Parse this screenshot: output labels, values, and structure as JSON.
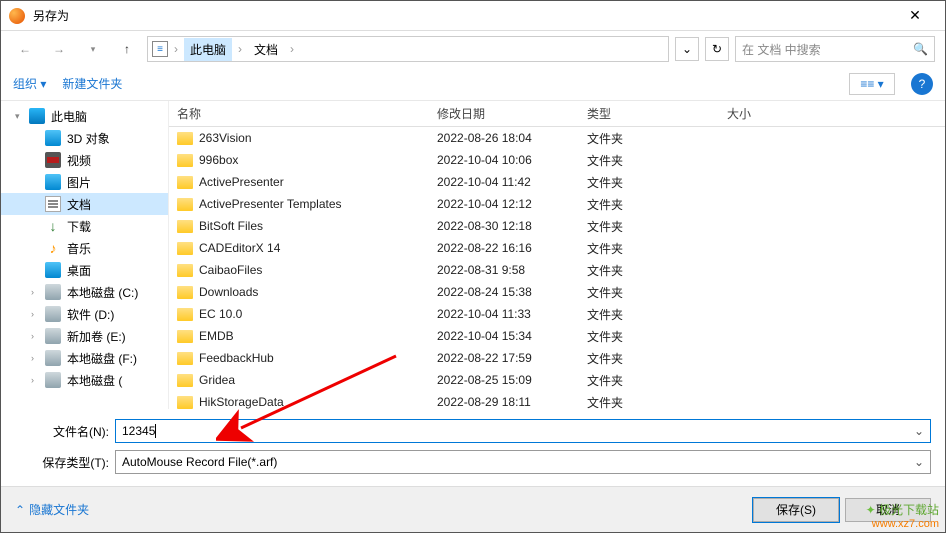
{
  "window": {
    "title": "另存为"
  },
  "breadcrumb": {
    "loc1": "此电脑",
    "loc2": "文档"
  },
  "search": {
    "placeholder": "在 文档 中搜索"
  },
  "toolbar": {
    "organize": "组织",
    "newfolder": "新建文件夹"
  },
  "sidebar": [
    {
      "label": "此电脑",
      "icon": "ico-pc",
      "indent": false,
      "exp": "▾"
    },
    {
      "label": "3D 对象",
      "icon": "ico-3d",
      "indent": true
    },
    {
      "label": "视频",
      "icon": "ico-video",
      "indent": true
    },
    {
      "label": "图片",
      "icon": "ico-pic",
      "indent": true
    },
    {
      "label": "文档",
      "icon": "ico-doc",
      "indent": true,
      "selected": true
    },
    {
      "label": "下载",
      "icon": "ico-dl",
      "indent": true,
      "glyph": "↓"
    },
    {
      "label": "音乐",
      "icon": "ico-music",
      "indent": true,
      "glyph": "♪"
    },
    {
      "label": "桌面",
      "icon": "ico-desk",
      "indent": true
    },
    {
      "label": "本地磁盘 (C:)",
      "icon": "ico-disk",
      "indent": true,
      "exp2": "›"
    },
    {
      "label": "软件 (D:)",
      "icon": "ico-disk",
      "indent": true,
      "exp2": "›"
    },
    {
      "label": "新加卷 (E:)",
      "icon": "ico-disk",
      "indent": true,
      "exp2": "›"
    },
    {
      "label": "本地磁盘 (F:)",
      "icon": "ico-disk",
      "indent": true,
      "exp2": "›"
    },
    {
      "label": "本地磁盘 (",
      "icon": "ico-disk",
      "indent": true,
      "exp2": "›"
    }
  ],
  "columns": {
    "name": "名称",
    "date": "修改日期",
    "type": "类型",
    "size": "大小"
  },
  "files": [
    {
      "name": "263Vision",
      "date": "2022-08-26 18:04",
      "type": "文件夹"
    },
    {
      "name": "996box",
      "date": "2022-10-04 10:06",
      "type": "文件夹"
    },
    {
      "name": "ActivePresenter",
      "date": "2022-10-04 11:42",
      "type": "文件夹"
    },
    {
      "name": "ActivePresenter Templates",
      "date": "2022-10-04 12:12",
      "type": "文件夹"
    },
    {
      "name": "BitSoft Files",
      "date": "2022-08-30 12:18",
      "type": "文件夹"
    },
    {
      "name": "CADEditorX 14",
      "date": "2022-08-22 16:16",
      "type": "文件夹"
    },
    {
      "name": "CaibaoFiles",
      "date": "2022-08-31 9:58",
      "type": "文件夹"
    },
    {
      "name": "Downloads",
      "date": "2022-08-24 15:38",
      "type": "文件夹"
    },
    {
      "name": "EC 10.0",
      "date": "2022-10-04 11:33",
      "type": "文件夹"
    },
    {
      "name": "EMDB",
      "date": "2022-10-04 15:34",
      "type": "文件夹"
    },
    {
      "name": "FeedbackHub",
      "date": "2022-08-22 17:59",
      "type": "文件夹"
    },
    {
      "name": "Gridea",
      "date": "2022-08-25 15:09",
      "type": "文件夹"
    },
    {
      "name": "HikStorageData",
      "date": "2022-08-29 18:11",
      "type": "文件夹"
    }
  ],
  "form": {
    "filename_label": "文件名(N):",
    "filename_value": "12345",
    "savetype_label": "保存类型(T):",
    "savetype_value": "AutoMouse Record File(*.arf)"
  },
  "footer": {
    "hide": "隐藏文件夹",
    "save": "保存(S)",
    "cancel": "取消"
  },
  "watermark": {
    "name": "极光下载站",
    "url": "www.xz7.com"
  }
}
